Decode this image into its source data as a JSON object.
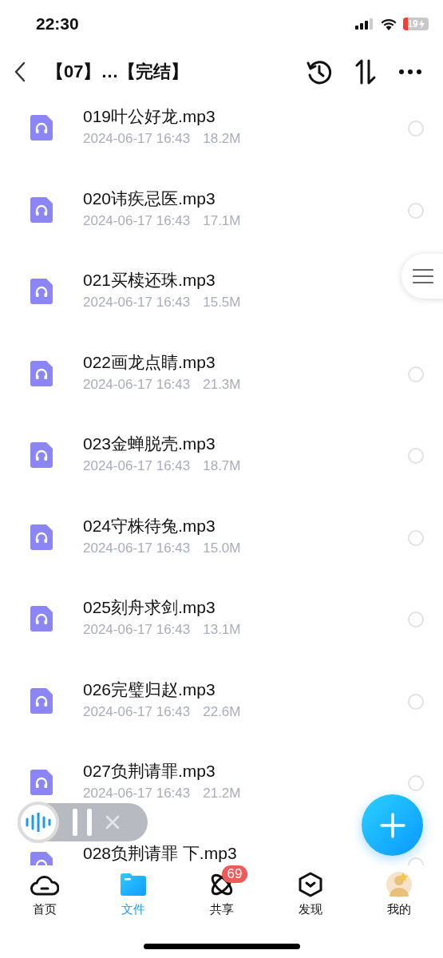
{
  "status_bar": {
    "time": "22:30",
    "battery": "19"
  },
  "header": {
    "title": "【07】…【完结】"
  },
  "files": [
    {
      "name": "019叶公好龙.mp3",
      "date": "2024-06-17 16:43",
      "size": "18.2M",
      "selected": false
    },
    {
      "name": "020讳疾忌医.mp3",
      "date": "2024-06-17 16:43",
      "size": "17.1M",
      "selected": false
    },
    {
      "name": "021买椟还珠.mp3",
      "date": "2024-06-17 16:43",
      "size": "15.5M"
    },
    {
      "name": "022画龙点睛.mp3",
      "date": "2024-06-17 16:43",
      "size": "21.3M",
      "selected": false
    },
    {
      "name": "023金蝉脱壳.mp3",
      "date": "2024-06-17 16:43",
      "size": "18.7M",
      "selected": false
    },
    {
      "name": "024守株待兔.mp3",
      "date": "2024-06-17 16:43",
      "size": "15.0M",
      "selected": false
    },
    {
      "name": "025刻舟求剑.mp3",
      "date": "2024-06-17 16:43",
      "size": "13.1M",
      "selected": false
    },
    {
      "name": "026完璧归赵.mp3",
      "date": "2024-06-17 16:43",
      "size": "22.6M",
      "selected": false
    },
    {
      "name": "027负荆请罪.mp3",
      "date": "2024-06-17 16:43",
      "size": "21.2M",
      "selected": false
    },
    {
      "name": "028负荆请罪 下.mp3",
      "selected": false
    }
  ],
  "tabs": [
    {
      "label": "首页",
      "kind": "home",
      "selected": false
    },
    {
      "label": "文件",
      "kind": "files",
      "selected": true
    },
    {
      "label": "共享",
      "kind": "share",
      "selected": false,
      "badge": "69"
    },
    {
      "label": "发现",
      "kind": "discover",
      "selected": false
    },
    {
      "label": "我的",
      "kind": "profile",
      "selected": false
    }
  ]
}
